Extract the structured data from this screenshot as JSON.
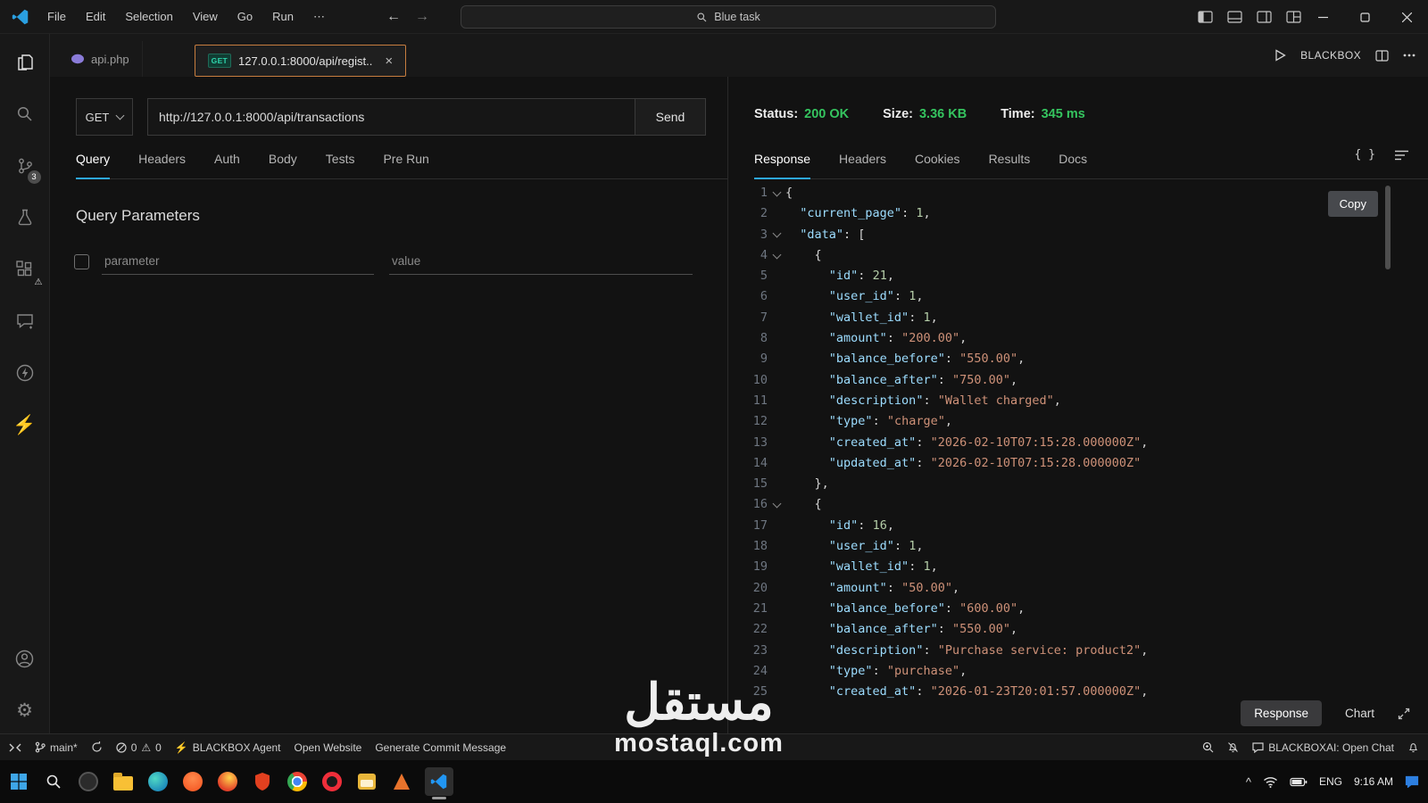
{
  "colors": {
    "accent_blue": "#2da8e8",
    "success_green": "#35c45f",
    "method_teal": "#2fd6ad",
    "focused_tab_border": "#c77d3f",
    "json_key": "#9cdcfe",
    "json_string": "#ce9178",
    "json_number": "#b5cea8"
  },
  "titlebar": {
    "menus": [
      "File",
      "Edit",
      "Selection",
      "View",
      "Go",
      "Run"
    ],
    "more_label": "⋯",
    "search_text": "Blue task"
  },
  "editor_tabs": {
    "file_tab": "api.php",
    "request_tab_method": "GET",
    "request_tab_label": "127.0.0.1:8000/api/regist..",
    "close_label": "×",
    "blackbox_label": "BLACKBOX"
  },
  "activitybar": {
    "scm_badge": "3",
    "icons": [
      "explorer",
      "search",
      "source-control",
      "beaker",
      "extensions",
      "chat",
      "thunder-client",
      "bolt",
      "account",
      "settings-gear"
    ]
  },
  "request": {
    "method": "GET",
    "url": "http://127.0.0.1:8000/api/transactions",
    "send_label": "Send",
    "tabs": [
      "Query",
      "Headers",
      "Auth",
      "Body",
      "Tests",
      "Pre Run"
    ],
    "active_tab": "Query",
    "section_title": "Query Parameters",
    "param_placeholder": "parameter",
    "value_placeholder": "value"
  },
  "response": {
    "status_label": "Status:",
    "status_value": "200 OK",
    "size_label": "Size:",
    "size_value": "3.36 KB",
    "time_label": "Time:",
    "time_value": "345 ms",
    "tabs": [
      "Response",
      "Headers",
      "Cookies",
      "Results",
      "Docs"
    ],
    "active_tab": "Response",
    "braces_icon": "{ }",
    "copy_label": "Copy",
    "footer": {
      "response_label": "Response",
      "chart_label": "Chart"
    },
    "json_lines": [
      {
        "fold": true,
        "seg": [
          [
            "pun",
            "{"
          ]
        ]
      },
      {
        "seg": [
          [
            "pun",
            "  "
          ],
          [
            "key",
            "\"current_page\""
          ],
          [
            "pun",
            ": "
          ],
          [
            "num",
            "1"
          ],
          [
            "pun",
            ","
          ]
        ]
      },
      {
        "fold": true,
        "seg": [
          [
            "pun",
            "  "
          ],
          [
            "key",
            "\"data\""
          ],
          [
            "pun",
            ": ["
          ]
        ]
      },
      {
        "fold": true,
        "seg": [
          [
            "pun",
            "    {"
          ]
        ]
      },
      {
        "seg": [
          [
            "pun",
            "      "
          ],
          [
            "key",
            "\"id\""
          ],
          [
            "pun",
            ": "
          ],
          [
            "num",
            "21"
          ],
          [
            "pun",
            ","
          ]
        ]
      },
      {
        "seg": [
          [
            "pun",
            "      "
          ],
          [
            "key",
            "\"user_id\""
          ],
          [
            "pun",
            ": "
          ],
          [
            "num",
            "1"
          ],
          [
            "pun",
            ","
          ]
        ]
      },
      {
        "seg": [
          [
            "pun",
            "      "
          ],
          [
            "key",
            "\"wallet_id\""
          ],
          [
            "pun",
            ": "
          ],
          [
            "num",
            "1"
          ],
          [
            "pun",
            ","
          ]
        ]
      },
      {
        "seg": [
          [
            "pun",
            "      "
          ],
          [
            "key",
            "\"amount\""
          ],
          [
            "pun",
            ": "
          ],
          [
            "str",
            "\"200.00\""
          ],
          [
            "pun",
            ","
          ]
        ]
      },
      {
        "seg": [
          [
            "pun",
            "      "
          ],
          [
            "key",
            "\"balance_before\""
          ],
          [
            "pun",
            ": "
          ],
          [
            "str",
            "\"550.00\""
          ],
          [
            "pun",
            ","
          ]
        ]
      },
      {
        "seg": [
          [
            "pun",
            "      "
          ],
          [
            "key",
            "\"balance_after\""
          ],
          [
            "pun",
            ": "
          ],
          [
            "str",
            "\"750.00\""
          ],
          [
            "pun",
            ","
          ]
        ]
      },
      {
        "seg": [
          [
            "pun",
            "      "
          ],
          [
            "key",
            "\"description\""
          ],
          [
            "pun",
            ": "
          ],
          [
            "str",
            "\"Wallet charged\""
          ],
          [
            "pun",
            ","
          ]
        ]
      },
      {
        "seg": [
          [
            "pun",
            "      "
          ],
          [
            "key",
            "\"type\""
          ],
          [
            "pun",
            ": "
          ],
          [
            "str",
            "\"charge\""
          ],
          [
            "pun",
            ","
          ]
        ]
      },
      {
        "seg": [
          [
            "pun",
            "      "
          ],
          [
            "key",
            "\"created_at\""
          ],
          [
            "pun",
            ": "
          ],
          [
            "str",
            "\"2026-02-10T07:15:28.000000Z\""
          ],
          [
            "pun",
            ","
          ]
        ]
      },
      {
        "seg": [
          [
            "pun",
            "      "
          ],
          [
            "key",
            "\"updated_at\""
          ],
          [
            "pun",
            ": "
          ],
          [
            "str",
            "\"2026-02-10T07:15:28.000000Z\""
          ]
        ]
      },
      {
        "seg": [
          [
            "pun",
            "    },"
          ]
        ]
      },
      {
        "fold": true,
        "seg": [
          [
            "pun",
            "    {"
          ]
        ]
      },
      {
        "seg": [
          [
            "pun",
            "      "
          ],
          [
            "key",
            "\"id\""
          ],
          [
            "pun",
            ": "
          ],
          [
            "num",
            "16"
          ],
          [
            "pun",
            ","
          ]
        ]
      },
      {
        "seg": [
          [
            "pun",
            "      "
          ],
          [
            "key",
            "\"user_id\""
          ],
          [
            "pun",
            ": "
          ],
          [
            "num",
            "1"
          ],
          [
            "pun",
            ","
          ]
        ]
      },
      {
        "seg": [
          [
            "pun",
            "      "
          ],
          [
            "key",
            "\"wallet_id\""
          ],
          [
            "pun",
            ": "
          ],
          [
            "num",
            "1"
          ],
          [
            "pun",
            ","
          ]
        ]
      },
      {
        "seg": [
          [
            "pun",
            "      "
          ],
          [
            "key",
            "\"amount\""
          ],
          [
            "pun",
            ": "
          ],
          [
            "str",
            "\"50.00\""
          ],
          [
            "pun",
            ","
          ]
        ]
      },
      {
        "seg": [
          [
            "pun",
            "      "
          ],
          [
            "key",
            "\"balance_before\""
          ],
          [
            "pun",
            ": "
          ],
          [
            "str",
            "\"600.00\""
          ],
          [
            "pun",
            ","
          ]
        ]
      },
      {
        "seg": [
          [
            "pun",
            "      "
          ],
          [
            "key",
            "\"balance_after\""
          ],
          [
            "pun",
            ": "
          ],
          [
            "str",
            "\"550.00\""
          ],
          [
            "pun",
            ","
          ]
        ]
      },
      {
        "seg": [
          [
            "pun",
            "      "
          ],
          [
            "key",
            "\"description\""
          ],
          [
            "pun",
            ": "
          ],
          [
            "str",
            "\"Purchase service: product2\""
          ],
          [
            "pun",
            ","
          ]
        ]
      },
      {
        "seg": [
          [
            "pun",
            "      "
          ],
          [
            "key",
            "\"type\""
          ],
          [
            "pun",
            ": "
          ],
          [
            "str",
            "\"purchase\""
          ],
          [
            "pun",
            ","
          ]
        ]
      },
      {
        "seg": [
          [
            "pun",
            "      "
          ],
          [
            "key",
            "\"created_at\""
          ],
          [
            "pun",
            ": "
          ],
          [
            "str",
            "\"2026-01-23T20:01:57.000000Z\""
          ],
          [
            "pun",
            ","
          ]
        ]
      }
    ]
  },
  "statusbar": {
    "branch": "main*",
    "errors": "0",
    "warnings": "0",
    "agent": "BLACKBOX Agent",
    "open_website": "Open Website",
    "commit": "Generate Commit Message",
    "chat": "BLACKBOXAI: Open Chat"
  },
  "taskbar": {
    "icons": [
      "windows-start",
      "search",
      "copilot",
      "file-explorer",
      "edge",
      "brave",
      "firefox",
      "shield-app",
      "chrome",
      "opera",
      "files-app",
      "vlc",
      "vscode"
    ],
    "tray": {
      "lang": "ENG",
      "time": "9:16 AM"
    }
  },
  "watermark": {
    "arabic": "مستقل",
    "latin": "mostaql.com"
  }
}
